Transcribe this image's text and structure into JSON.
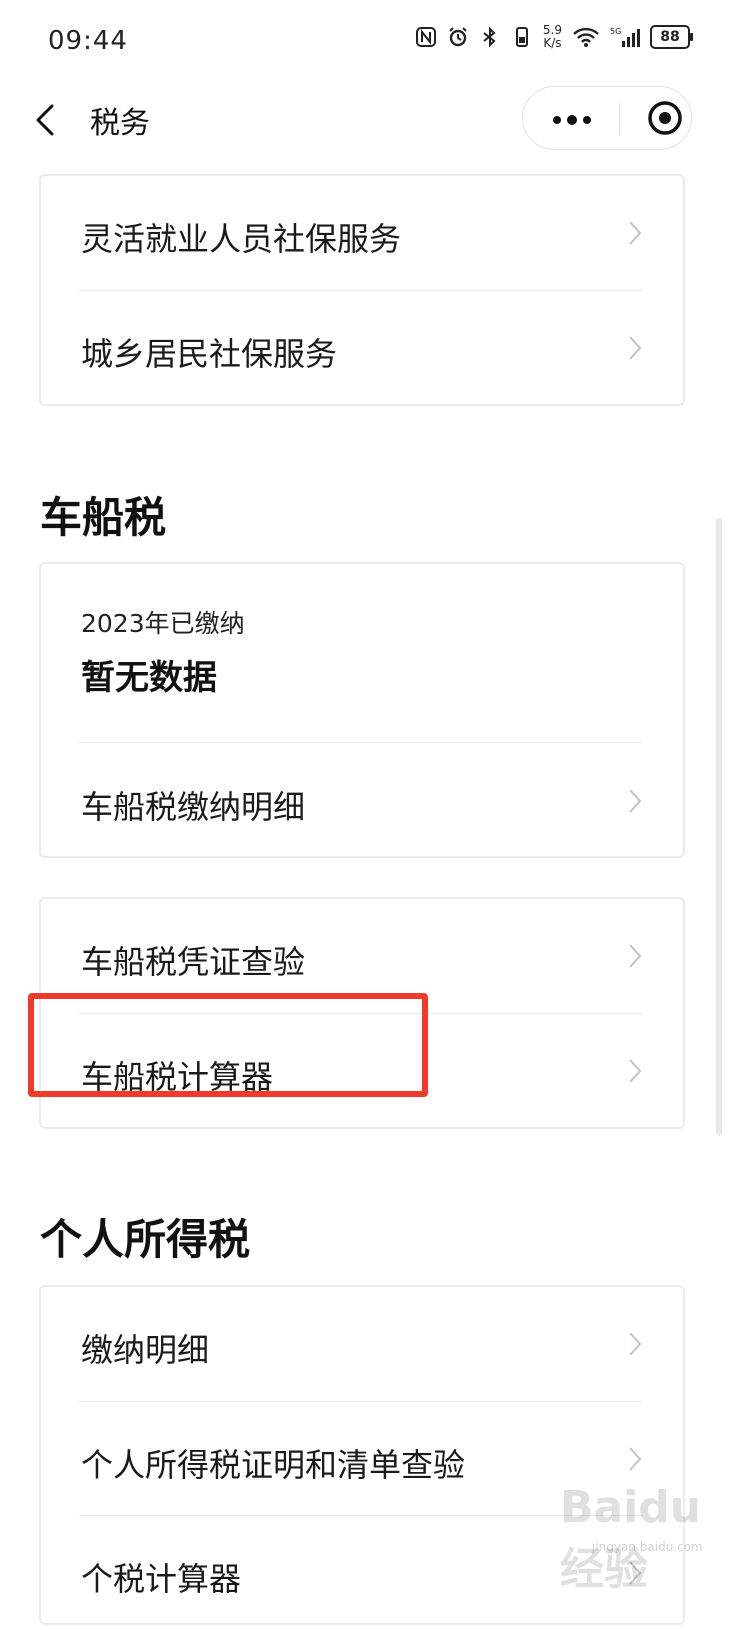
{
  "status_bar": {
    "time": "09:44",
    "speed_value": "5.9",
    "speed_unit": "K/s",
    "battery": "88",
    "icons": [
      "nfc-icon",
      "alarm-icon",
      "bluetooth-icon",
      "vibrate-icon",
      "wifi-icon",
      "signal-5g-icon",
      "battery-icon"
    ]
  },
  "nav": {
    "title": "税务",
    "back_icon": "chevron-left-icon",
    "more_icon": "more-dots-icon",
    "close_icon": "target-close-icon"
  },
  "social_security_card": {
    "items": [
      {
        "label": "灵活就业人员社保服务"
      },
      {
        "label": "城乡居民社保服务"
      }
    ]
  },
  "vehicle_tax": {
    "section_title": "车船税",
    "paid_label": "2023年已缴纳",
    "paid_value": "暂无数据",
    "detail_item": "车船税缴纳明细",
    "tools": [
      {
        "label": "车船税凭证查验"
      },
      {
        "label": "车船税计算器",
        "highlighted": true
      }
    ]
  },
  "income_tax": {
    "section_title": "个人所得税",
    "items": [
      {
        "label": "缴纳明细"
      },
      {
        "label": "个人所得税证明和清单查验"
      },
      {
        "label": "个税计算器"
      }
    ]
  },
  "highlight_color": "#f23a2b",
  "watermark": {
    "text": "Baidu经验",
    "url": "jingyan.baidu.com"
  }
}
